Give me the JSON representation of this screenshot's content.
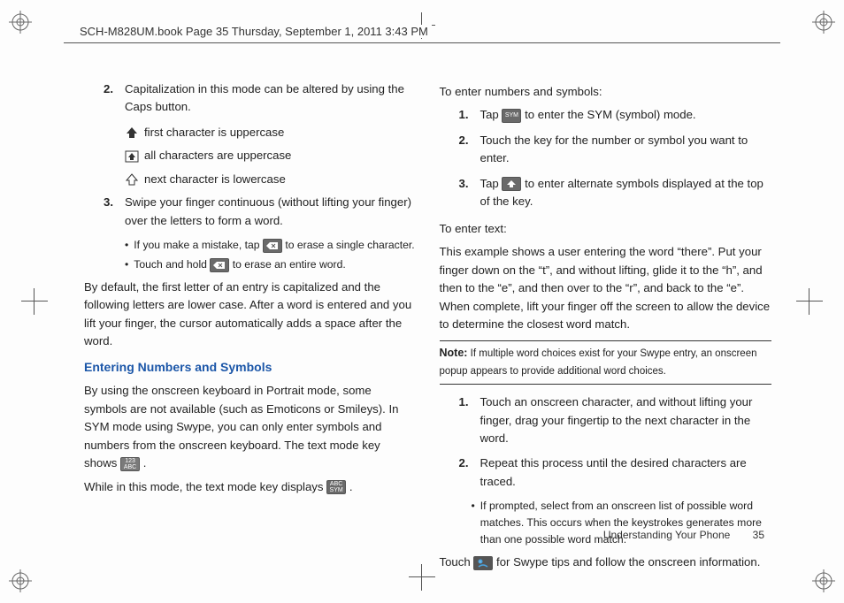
{
  "header": {
    "running_head": "SCH-M828UM.book  Page 35  Thursday, September 1, 2011  3:43 PM"
  },
  "left": {
    "item2": {
      "num": "2.",
      "text": "Capitalization in this mode can be altered by using the Caps button."
    },
    "cap_lines": {
      "upper_first": "first character is uppercase",
      "upper_all": "all characters are uppercase",
      "lower_next": "next character is lowercase"
    },
    "item3": {
      "num": "3.",
      "text": "Swipe your finger continuous (without lifting your finger) over the letters to form a word."
    },
    "bullets": {
      "b1_pre": "If you make a mistake, tap ",
      "b1_post": " to erase a single character.",
      "b2_pre": "Touch and hold ",
      "b2_post": " to erase an entire word."
    },
    "default_para": "By default, the first letter of an entry is capitalized and the following letters are lower case. After a word is entered and you lift your finger, the cursor automatically adds a space after the word.",
    "subhead": "Entering Numbers and Symbols",
    "sym_para1_pre": "By using the onscreen keyboard in Portrait mode, some symbols are not available (such as Emoticons or Smileys). In SYM mode using Swype, you can only enter symbols and numbers from the onscreen keyboard. The text mode key shows ",
    "sym_para1_post": ".",
    "sym_para2_pre": "While in this mode, the text mode key displays ",
    "sym_para2_post": "."
  },
  "right": {
    "enter_nums_heading": "To enter numbers and symbols:",
    "r1": {
      "num": "1.",
      "pre": "Tap ",
      "post": " to enter the SYM (symbol) mode."
    },
    "r2": {
      "num": "2.",
      "text": "Touch the key for the number or symbol you want to enter."
    },
    "r3": {
      "num": "3.",
      "pre": "Tap ",
      "post": " to enter alternate symbols displayed at the top of the key."
    },
    "enter_text_heading": "To enter text:",
    "example_para": "This example shows a user entering the word “there”. Put your finger down on the “t”, and without lifting, glide it to the “h”, and then to the “e”, and then over to the “r”, and back to the “e”. When complete, lift your finger off the screen to allow the device to determine the closest word match.",
    "note_label": "Note:",
    "note_text": " If multiple word choices exist for your Swype entry, an onscreen popup appears to provide additional word choices.",
    "t1": {
      "num": "1.",
      "text": "Touch an onscreen character, and without lifting your finger, drag your fingertip to the next character in the word."
    },
    "t2": {
      "num": "2.",
      "text": "Repeat this process until the desired characters are traced."
    },
    "tbullet": "If prompted, select from an onscreen list of possible word matches. This occurs when the keystrokes generates more than one possible word match.",
    "touch_pre": "Touch ",
    "touch_post": " for Swype tips and follow the onscreen information."
  },
  "icons": {
    "key_abc123": "123\nABC",
    "key_sym": "SYM",
    "key_abcsym": "ABC\nSYM"
  },
  "footer": {
    "section": "Understanding Your Phone",
    "page": "35"
  }
}
